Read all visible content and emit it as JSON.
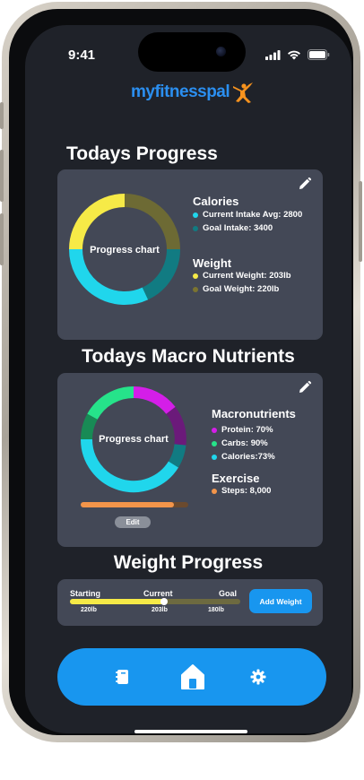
{
  "status_bar": {
    "time": "9:41"
  },
  "app": {
    "logo_text": "myfitnesspal",
    "brand_color": "#2b8ff0",
    "logo_figure_color": "#f7931e"
  },
  "todays_progress": {
    "title": "Todays Progress",
    "chart_label": "Progress chart",
    "calories": {
      "title": "Calories",
      "items": [
        {
          "label": "Current Intake Avg: 2800",
          "color": "#20d6ec"
        },
        {
          "label": "Goal Intake: 3400",
          "color": "#117b82"
        }
      ]
    },
    "weight": {
      "title": "Weight",
      "items": [
        {
          "label": "Current Weight: 203lb",
          "color": "#f6ea47"
        },
        {
          "label": "Goal Weight: 220lb",
          "color": "#7b7430"
        }
      ]
    },
    "edit_icon": "pencil-icon"
  },
  "macro_nutrients": {
    "title": "Todays Macro Nutrients",
    "chart_label": "Progress chart",
    "macronutrients": {
      "title": "Macronutrients",
      "items": [
        {
          "label": "Protein: 70%",
          "color": "#d41ee8"
        },
        {
          "label": "Carbs: 90%",
          "color": "#26e38a"
        },
        {
          "label": "Calories:73%",
          "color": "#20d6ec"
        }
      ]
    },
    "exercise": {
      "title": "Exercise",
      "items": [
        {
          "label": "Steps: 8,000",
          "color": "#f3954a"
        }
      ]
    },
    "steps_progress": 0.87,
    "edit_label": "Edit",
    "edit_icon": "pencil-icon"
  },
  "weight_progress": {
    "title": "Weight Progress",
    "starting_label": "Starting",
    "starting_value": "220lb",
    "current_label": "Current",
    "current_value": "203lb",
    "goal_label": "Goal",
    "goal_value": "180lb",
    "progress": 0.55,
    "add_button": "Add Weight"
  },
  "tabbar": {
    "items": [
      {
        "icon": "diary-icon"
      },
      {
        "icon": "home-icon",
        "active": true
      },
      {
        "icon": "gear-icon"
      }
    ],
    "color": "#1896ef"
  }
}
